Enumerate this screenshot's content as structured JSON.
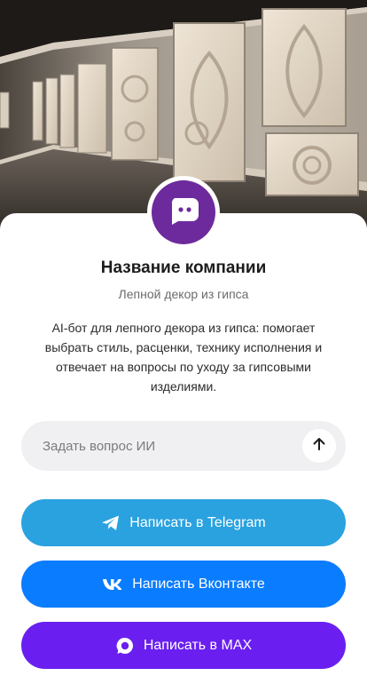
{
  "company": {
    "name": "Название компании",
    "subtitle": "Лепной декор из гипса",
    "description": "AI-бот для лепного декора из гипса: помогает выбрать стиль, расценки, технику исполнения и отвечает на вопросы по уходу за гипсовыми изделиями."
  },
  "ask": {
    "placeholder": "Задать вопрос ИИ",
    "send_icon": "arrow-up-icon"
  },
  "buttons": {
    "telegram": {
      "label": "Написать в Telegram",
      "icon": "telegram-icon",
      "color": "#2aa2df"
    },
    "vk": {
      "label": "Написать Вконтакте",
      "icon": "vk-icon",
      "color": "#0a7cff"
    },
    "max": {
      "label": "Написать в MAX",
      "icon": "max-icon",
      "color": "#6a1ff0"
    }
  },
  "avatar": {
    "icon": "chat-bot-icon",
    "color": "#6d2a9c"
  }
}
